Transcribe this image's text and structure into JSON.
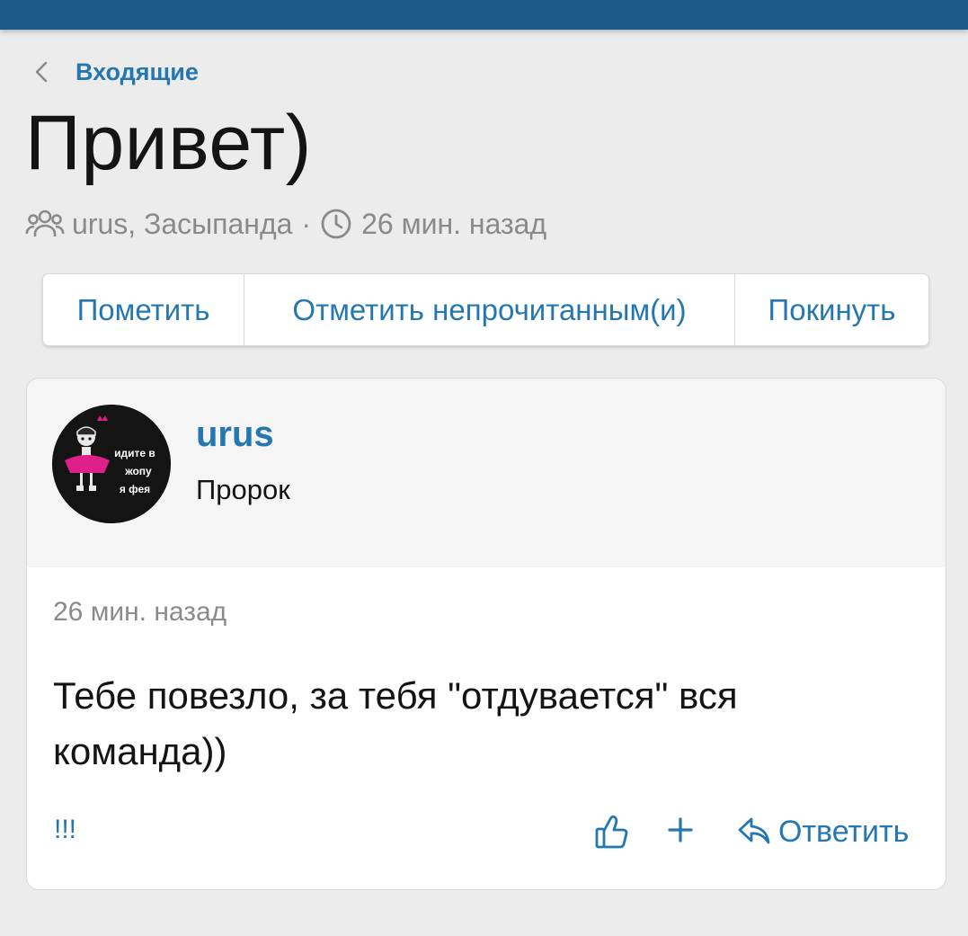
{
  "header": {
    "bar_color": "#1d5a8a"
  },
  "breadcrumb": {
    "icon": "chevron-left-icon",
    "label": "Входящие"
  },
  "conversation": {
    "title": "Привет)",
    "participants_icon": "users-icon",
    "participants": "urus, Засыпанда",
    "separator": "·",
    "time_icon": "clock-icon",
    "time": "26 мин. назад"
  },
  "actions": {
    "mark_label": "Пометить",
    "unread_label": "Отметить непрочитанным(и)",
    "leave_label": "Покинуть"
  },
  "message": {
    "avatar_text": [
      "идите в",
      "жопу",
      "я фея"
    ],
    "author": "urus",
    "role": "Пророк",
    "time": "26 мин. назад",
    "text": "Тебе повезло, за тебя \"отдувается\" вся команда))",
    "flag_label": "!!!",
    "like_icon": "thumbs-up-icon",
    "add_icon": "plus-icon",
    "reply_icon": "reply-icon",
    "reply_label": "Ответить"
  },
  "colors": {
    "accent": "#2577b1",
    "text": "#141414",
    "muted": "#8a8a8a",
    "background": "#ececec"
  }
}
